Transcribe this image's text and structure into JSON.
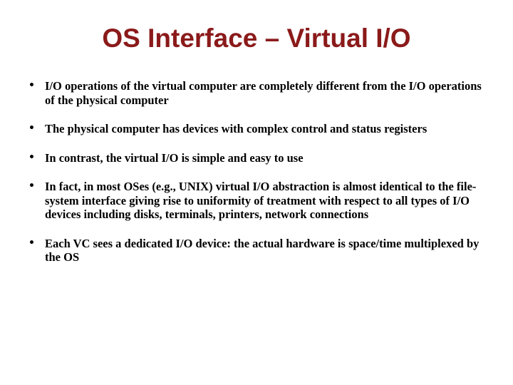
{
  "slide": {
    "title": "OS Interface – Virtual I/O",
    "title_color": "#8b1a1a",
    "bullet_symbol": "•",
    "bullets": [
      "I/O operations of the virtual computer are completely different from the I/O operations of the physical computer",
      "The physical computer has devices with complex control and status registers",
      "In contrast, the virtual I/O is simple and easy to use",
      "In fact, in most OSes (e.g., UNIX) virtual I/O abstraction is almost identical to the file-system interface giving rise to uniformity of treatment with respect to all types of I/O devices including disks, terminals, printers, network connections",
      "Each VC sees a dedicated I/O device: the actual hardware is space/time multiplexed by the OS"
    ]
  }
}
